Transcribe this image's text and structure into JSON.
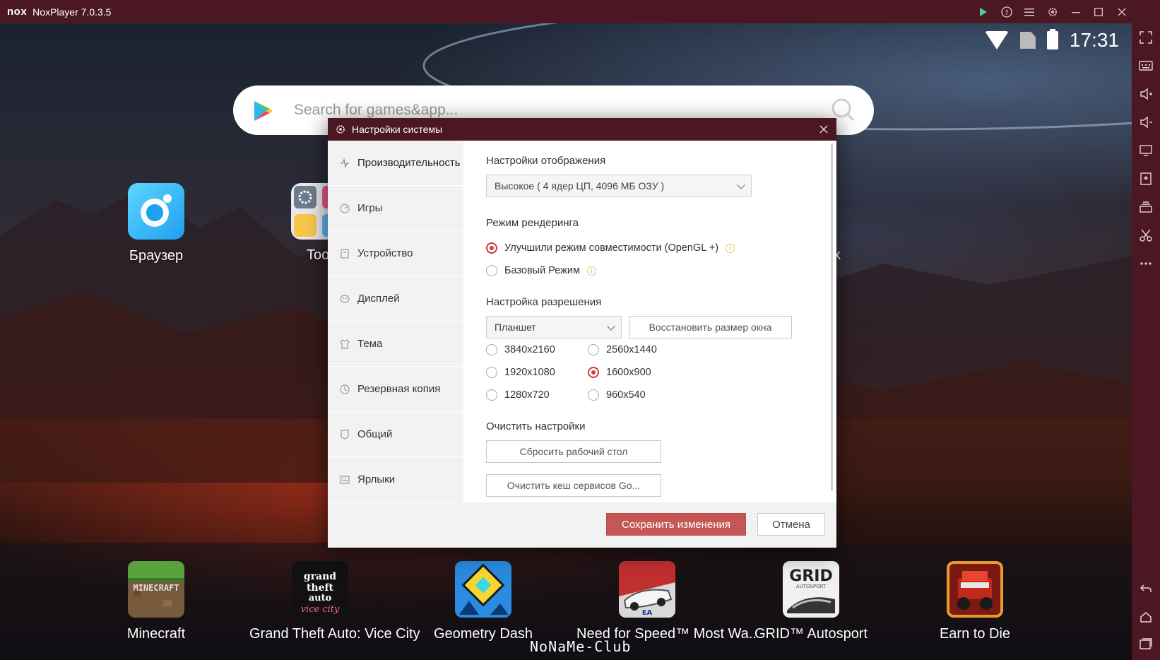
{
  "window": {
    "logo": "nox",
    "title": "NoxPlayer 7.0.3.5",
    "controls": [
      "play-store-icon",
      "help-icon",
      "menu-icon",
      "settings-icon",
      "minimize-icon",
      "maximize-icon",
      "close-icon"
    ]
  },
  "status": {
    "time": "17:31",
    "icons": [
      "wifi-icon",
      "no-sim-icon",
      "battery-icon"
    ]
  },
  "search": {
    "placeholder": "Search for games&app..."
  },
  "desktop_icons": [
    {
      "label": "Браузер",
      "icon": "browser-icon"
    },
    {
      "label": "Tool",
      "icon": "tools-folder-icon"
    },
    {
      "label": "k",
      "icon": "partial-app-icon"
    }
  ],
  "dock_apps": [
    {
      "label": "Minecraft",
      "icon": "minecraft-icon"
    },
    {
      "label": "Grand Theft Auto: Vice City",
      "icon": "gta-vice-city-icon"
    },
    {
      "label": "Geometry Dash",
      "icon": "geometry-dash-icon"
    },
    {
      "label": "Need for Speed™ Most Wa..",
      "icon": "nfs-most-wanted-icon"
    },
    {
      "label": "GRID™ Autosport",
      "icon": "grid-autosport-icon"
    },
    {
      "label": "Earn to Die",
      "icon": "earn-to-die-icon"
    }
  ],
  "sidebar_tools": [
    "fullscreen-icon",
    "keyboard-icon",
    "volume-up-icon",
    "volume-down-icon",
    "screen-icon",
    "add-apk-icon",
    "stack-icon",
    "scissors-icon",
    "more-icon",
    "back-icon",
    "home-icon",
    "recents-icon"
  ],
  "dialog": {
    "title": "Настройки системы",
    "nav": [
      {
        "label": "Производительность",
        "icon": "performance-icon",
        "active": true
      },
      {
        "label": "Игры",
        "icon": "games-icon"
      },
      {
        "label": "Устройство",
        "icon": "device-icon"
      },
      {
        "label": "Дисплей",
        "icon": "display-icon"
      },
      {
        "label": "Тема",
        "icon": "theme-icon"
      },
      {
        "label": "Резервная копия",
        "icon": "backup-icon"
      },
      {
        "label": "Общий",
        "icon": "general-icon"
      },
      {
        "label": "Ярлыки",
        "icon": "shortcuts-icon"
      }
    ],
    "display_settings": {
      "heading": "Настройки отображения",
      "selected": "Высокое ( 4 ядер ЦП, 4096 МБ ОЗУ )"
    },
    "render_mode": {
      "heading": "Режим рендеринга",
      "options": [
        {
          "label": "Улучшили режим совместимости (OpenGL +)",
          "checked": true
        },
        {
          "label": "Базовый Режим",
          "checked": false
        }
      ]
    },
    "resolution": {
      "heading": "Настройка разрешения",
      "selected": "Планшет",
      "restore_label": "Восстановить размер окна",
      "options": [
        {
          "label": "3840x2160",
          "checked": false
        },
        {
          "label": "2560x1440",
          "checked": false
        },
        {
          "label": "1920x1080",
          "checked": false
        },
        {
          "label": "1600x900",
          "checked": true
        },
        {
          "label": "1280x720",
          "checked": false
        },
        {
          "label": "960x540",
          "checked": false
        }
      ]
    },
    "clear": {
      "heading": "Очистить настройки",
      "reset_label": "Сбросить рабочий стол",
      "cache_label": "Очистить кеш сервисов Go..."
    },
    "save_label": "Сохранить изменения",
    "cancel_label": "Отмена"
  },
  "watermark": "NoNaMe-Club",
  "colors": {
    "titlebar": "#4b1722",
    "accent": "#cf3c44",
    "save_button": "#c65756"
  }
}
